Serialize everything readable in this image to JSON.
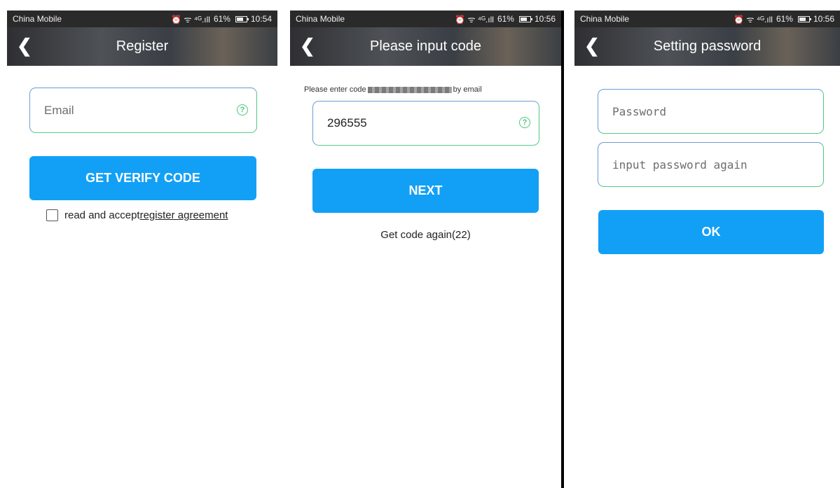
{
  "screens": [
    {
      "status": {
        "carrier": "China Mobile",
        "icons": "⏰ ᯤ ⁴ᴳ.ıll",
        "battery": "61%",
        "time": "10:54"
      },
      "title": "Register",
      "email_placeholder": "Email",
      "help_icon": "?",
      "button": "GET VERIFY CODE",
      "agree_text": "read and accept",
      "agree_link": "register agreement"
    },
    {
      "status": {
        "carrier": "China Mobile",
        "icons": "⏰ ᯤ ⁴ᴳ.ıll",
        "battery": "61%",
        "time": "10:56"
      },
      "title": "Please input code",
      "hint_prefix": "Please enter code ",
      "hint_suffix": " by email",
      "code_value": "296555",
      "help_icon": "?",
      "button": "NEXT",
      "resend": "Get code again(22)"
    },
    {
      "status": {
        "carrier": "China Mobile",
        "icons": "⏰ ᯤ ⁴ᴳ.ıll",
        "battery": "61%",
        "time": "10:56"
      },
      "title": "Setting password",
      "password_placeholder": "Password",
      "password_again_placeholder": "input password again",
      "button": "OK"
    }
  ],
  "colors": {
    "accent": "#12a0f6",
    "field_border_start": "#6c9bd6",
    "field_border_end": "#4fc77e"
  }
}
